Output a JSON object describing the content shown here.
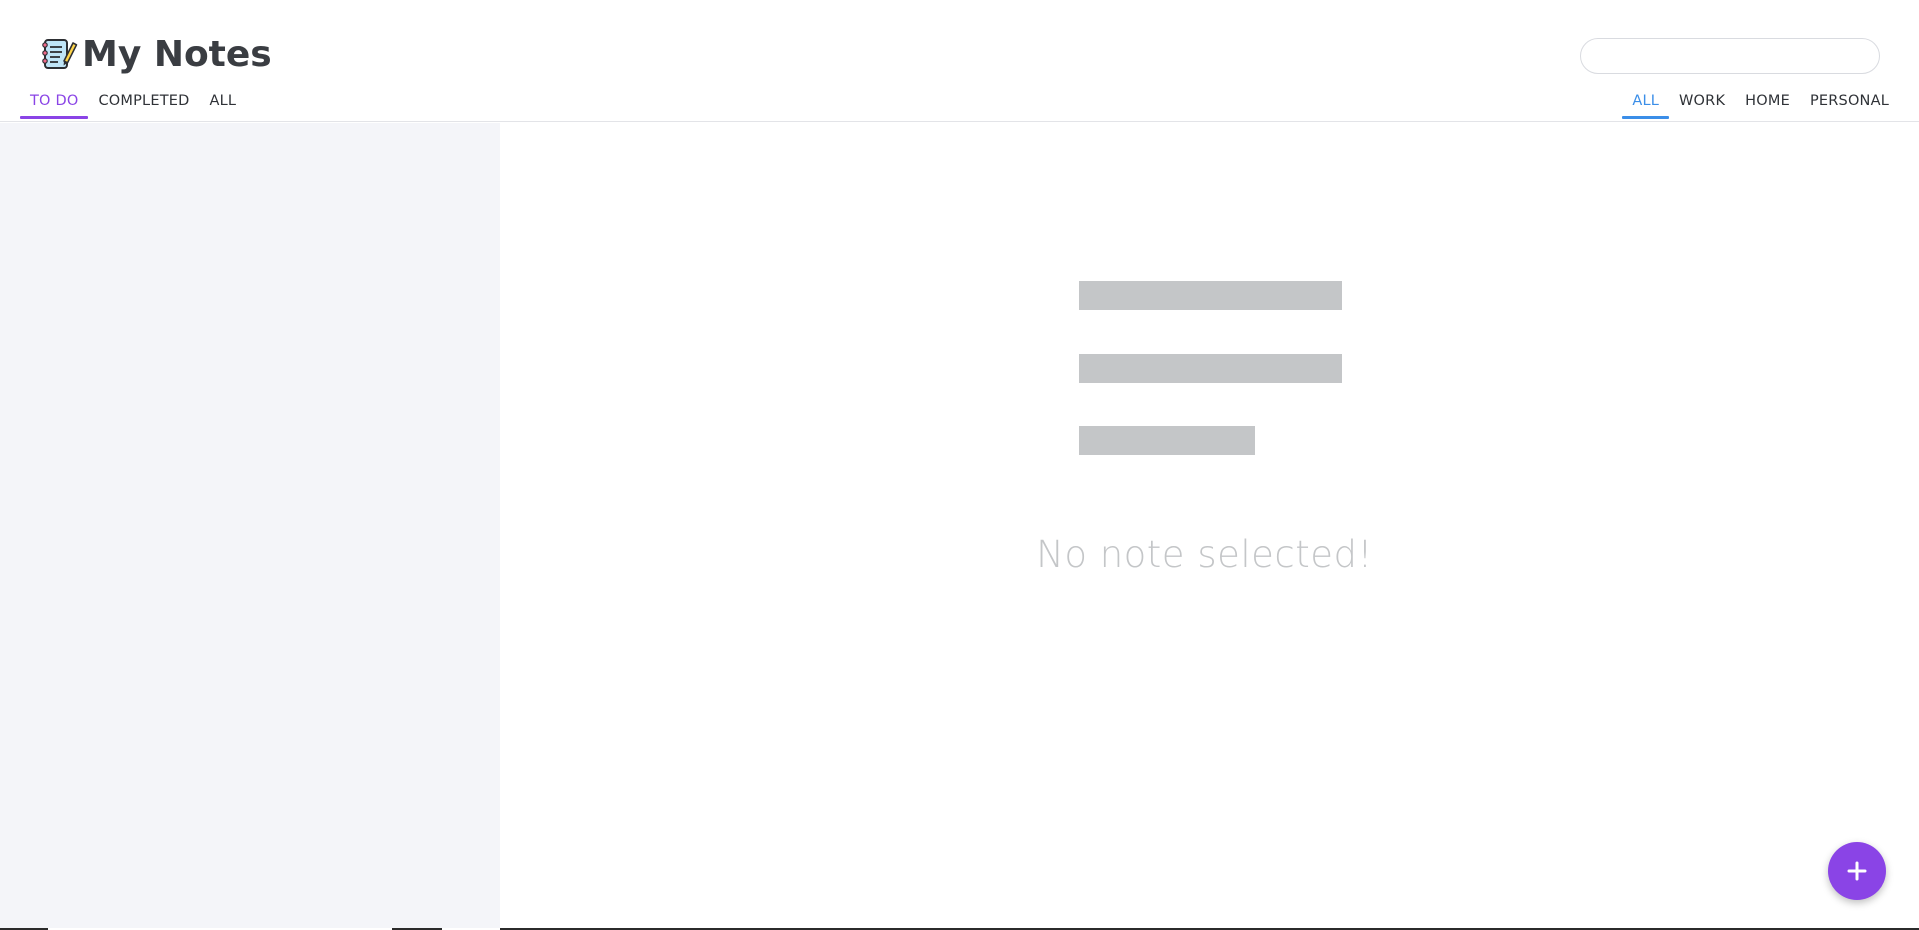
{
  "app": {
    "title": "My Notes",
    "brand_icon": "notebook-pencil-icon"
  },
  "search": {
    "value": "",
    "placeholder": ""
  },
  "status_tabs": [
    {
      "label": "TO DO",
      "active": true
    },
    {
      "label": "COMPLETED",
      "active": false
    },
    {
      "label": "ALL",
      "active": false
    }
  ],
  "category_tabs": [
    {
      "label": "ALL",
      "active": true
    },
    {
      "label": "WORK",
      "active": false
    },
    {
      "label": "HOME",
      "active": false
    },
    {
      "label": "PERSONAL",
      "active": false
    }
  ],
  "main": {
    "empty_message": "No note selected!"
  },
  "fab": {
    "icon": "plus-icon"
  },
  "colors": {
    "accent_purple": "#8a44e6",
    "accent_blue": "#3b8ee8",
    "sidebar_bg": "#f4f5f9",
    "placeholder_gray": "#c4c6c8"
  }
}
